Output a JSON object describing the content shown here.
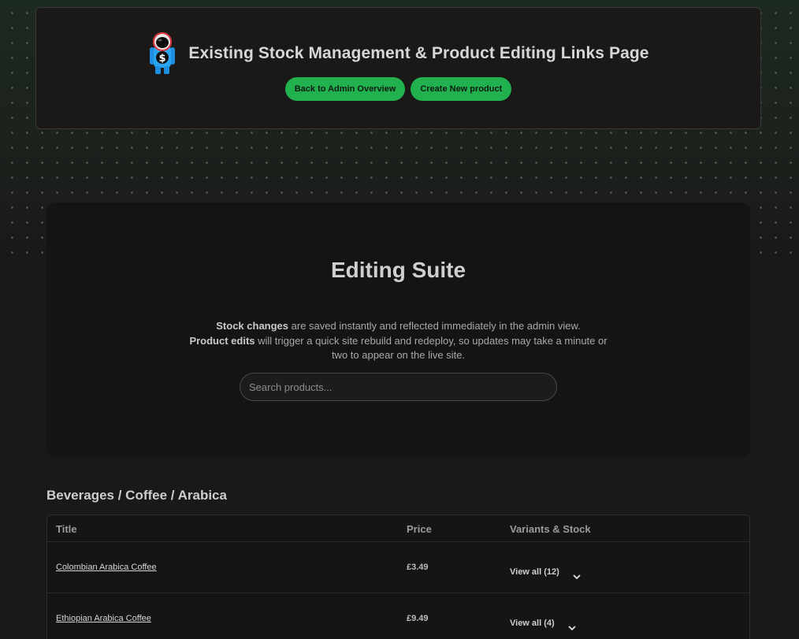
{
  "header": {
    "title": "Existing Stock Management & Product Editing Links Page",
    "buttons": {
      "back": "Back to Admin Overview",
      "create": "Create New product"
    },
    "logo_icon": "astronaut-dollar-icon"
  },
  "suite": {
    "title": "Editing Suite",
    "desc_stock_bold": "Stock changes",
    "desc_stock_rest": " are saved instantly and reflected immediately in the admin view.",
    "desc_product_bold": "Product edits",
    "desc_product_rest": " will trigger a quick site rebuild and redeploy, so updates may take a minute or two to appear on the live site.",
    "search_placeholder": "Search products..."
  },
  "category": {
    "heading": "Beverages / Coffee / Arabica",
    "columns": [
      "Title",
      "Price",
      "Variants & Stock"
    ],
    "rows": [
      {
        "title": "Colombian Arabica Coffee",
        "price": "£3.49",
        "variants": "View all (12)"
      },
      {
        "title": "Ethiopian Arabica Coffee",
        "price": "£9.49",
        "variants": "View all (4)"
      }
    ]
  },
  "colors": {
    "accent": "#21b24f",
    "background": "#1b1818",
    "panel": "#151313"
  }
}
